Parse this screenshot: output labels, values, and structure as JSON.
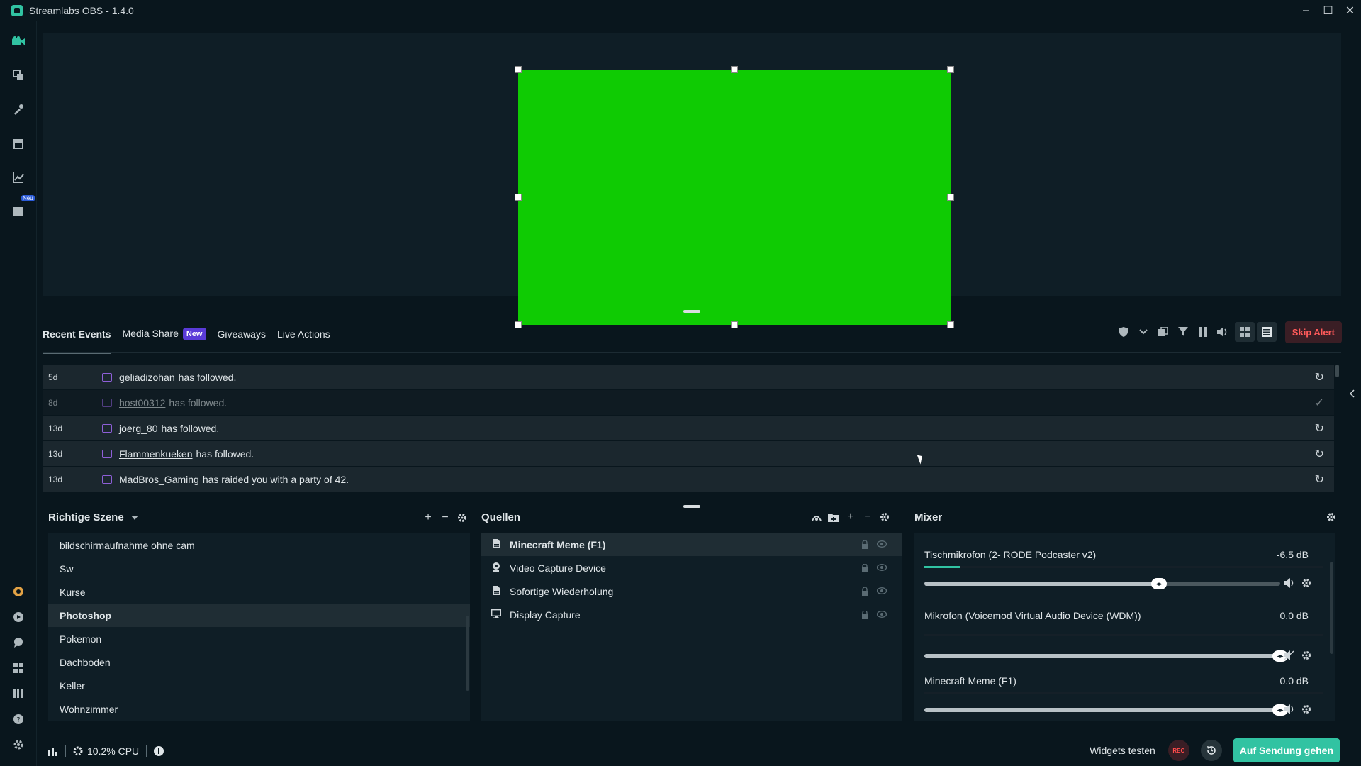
{
  "window": {
    "title": "Streamlabs OBS - 1.4.0",
    "controls": [
      "–",
      "☐",
      "✕"
    ]
  },
  "colors": {
    "accent": "#31c3a2",
    "greenscreen": "#0fcb03",
    "skip_alert_text": "#ff5a5a",
    "new_badge": "#5a3bd8",
    "twitch": "#8e5fd8"
  },
  "sidebar": {
    "top_icons": [
      "studio-icon",
      "layout-icon",
      "themes-icon",
      "store-icon",
      "analytics-icon",
      "highlighter-icon"
    ],
    "new_badge": "Neu",
    "bottom_icons": [
      "prime-icon",
      "cloudbot-icon",
      "chat-icon",
      "layout-editor-icon",
      "library-icon",
      "help-icon",
      "settings-icon"
    ]
  },
  "events": {
    "tabs": [
      {
        "label": "Recent Events",
        "active": true
      },
      {
        "label": "Media Share",
        "badge": "New"
      },
      {
        "label": "Giveaways"
      },
      {
        "label": "Live Actions"
      }
    ],
    "skip_alert": "Skip Alert",
    "rows": [
      {
        "time": "5d",
        "name": "geliadizohan",
        "text": "has followed.",
        "action": "↻",
        "dim": false
      },
      {
        "time": "8d",
        "name": "host00312",
        "text": "has followed.",
        "action": "✓",
        "dim": true
      },
      {
        "time": "13d",
        "name": "joerg_80",
        "text": "has followed.",
        "action": "↻",
        "dim": false
      },
      {
        "time": "13d",
        "name": "Flammenkueken",
        "text": "has followed.",
        "action": "↻",
        "dim": false
      },
      {
        "time": "13d",
        "name": "MadBros_Gaming",
        "text": "has raided you with a party of 42.",
        "action": "↻",
        "dim": false
      }
    ]
  },
  "scenes": {
    "collection": "Richtige Szene",
    "items": [
      {
        "label": "bildschirmaufnahme ohne cam",
        "selected": false
      },
      {
        "label": "Sw",
        "selected": false
      },
      {
        "label": "Kurse",
        "selected": false
      },
      {
        "label": "Photoshop",
        "selected": true
      },
      {
        "label": "Pokemon",
        "selected": false
      },
      {
        "label": "Dachboden",
        "selected": false
      },
      {
        "label": "Keller",
        "selected": false
      },
      {
        "label": "Wohnzimmer",
        "selected": false
      }
    ]
  },
  "sources": {
    "title": "Quellen",
    "items": [
      {
        "label": "Minecraft Meme (F1)",
        "icon": "file-icon",
        "selected": true
      },
      {
        "label": "Video Capture Device",
        "icon": "webcam-icon",
        "selected": false
      },
      {
        "label": "Sofortige Wiederholung",
        "icon": "file-icon",
        "selected": false
      },
      {
        "label": "Display Capture",
        "icon": "monitor-icon",
        "selected": false
      }
    ]
  },
  "mixer": {
    "title": "Mixer",
    "items": [
      {
        "name": "Tischmikrofon (2- RODE Podcaster v2)",
        "db": "-6.5 dB",
        "meter_level": 0.09,
        "volume": 0.66,
        "muted": false
      },
      {
        "name": "Mikrofon (Voicemod Virtual Audio Device (WDM))",
        "db": "0.0 dB",
        "meter_level": 0.0,
        "volume": 1.0,
        "muted": true
      },
      {
        "name": "Minecraft Meme (F1)",
        "db": "0.0 dB",
        "meter_level": 0.0,
        "volume": 1.0,
        "muted": false
      }
    ]
  },
  "footer": {
    "cpu": "10.2% CPU",
    "widgets_test": "Widgets testen",
    "rec": "REC",
    "go_live": "Auf Sendung gehen"
  }
}
